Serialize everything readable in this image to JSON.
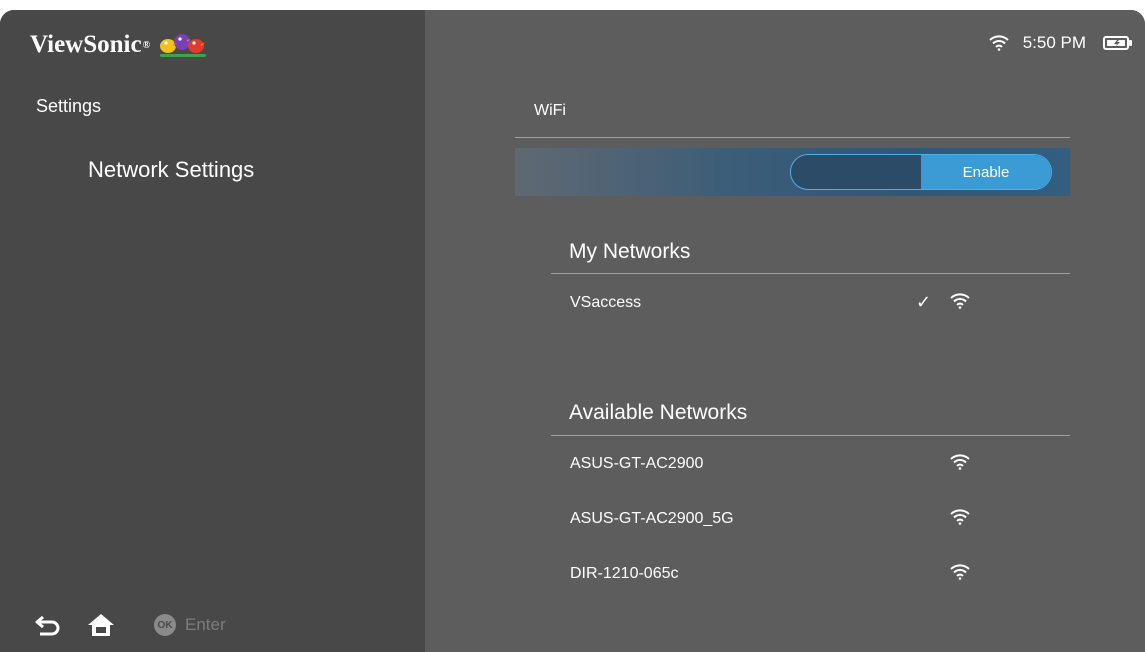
{
  "brand": {
    "name": "ViewSonic",
    "reg": "®",
    "logo_icon": "birds-logo-icon"
  },
  "left": {
    "heading": "Settings",
    "selected_item": "Network Settings",
    "bottom": {
      "back_icon": "back-arrow-icon",
      "home_icon": "home-icon",
      "ok_badge": "OK",
      "enter_label": "Enter"
    }
  },
  "status": {
    "wifi_icon": "wifi-icon",
    "time": "5:50 PM",
    "battery_icon": "battery-charging-icon"
  },
  "wifi": {
    "title": "WiFi",
    "toggle_label": "Enable",
    "toggle_state": "on",
    "accent": "#3a9bd5"
  },
  "my_networks": {
    "title": "My Networks",
    "items": [
      {
        "name": "VSaccess",
        "connected": true
      }
    ]
  },
  "available_networks": {
    "title": "Available Networks",
    "items": [
      {
        "name": "ASUS-GT-AC2900"
      },
      {
        "name": "ASUS-GT-AC2900_5G"
      },
      {
        "name": "DIR-1210-065c"
      }
    ]
  }
}
